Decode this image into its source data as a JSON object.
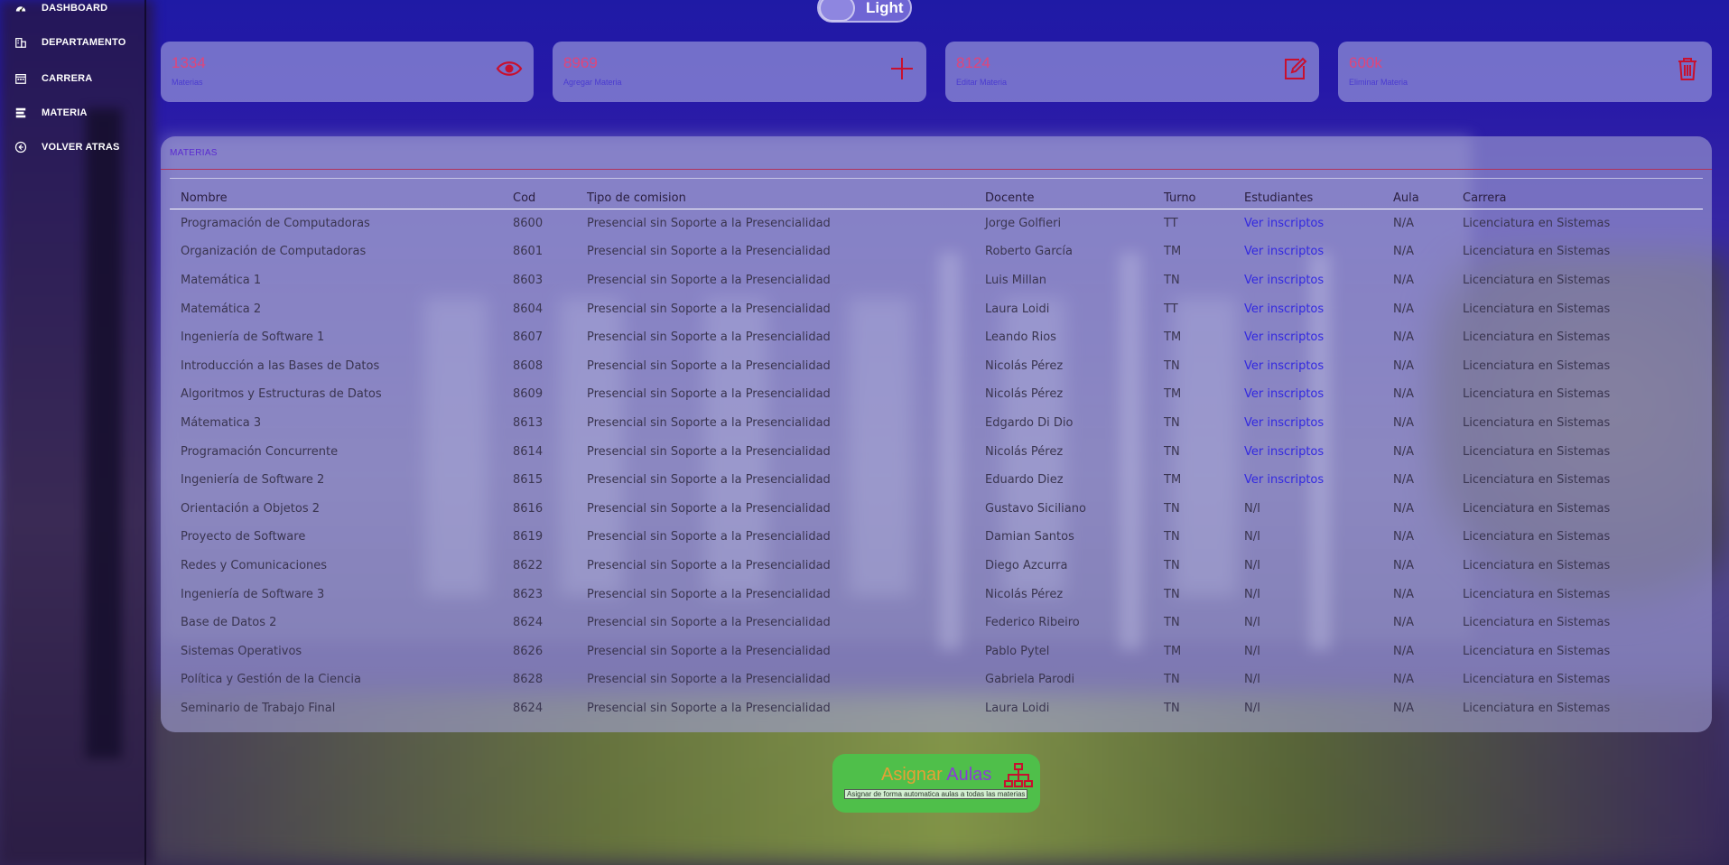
{
  "sidebar": {
    "items": [
      {
        "label": "DASHBOARD",
        "icon": "dashboard-gauge-icon"
      },
      {
        "label": "DEPARTAMENTO",
        "icon": "building-icon"
      },
      {
        "label": "CARRERA",
        "icon": "calendar-icon"
      },
      {
        "label": "MATERIA",
        "icon": "layers-icon"
      },
      {
        "label": "VOLVER ATRAS",
        "icon": "arrow-left-circle-icon"
      }
    ]
  },
  "theme_toggle": {
    "label": "Light"
  },
  "cards": [
    {
      "value": "1334",
      "label": "Materias",
      "icon": "eye-icon"
    },
    {
      "value": "8969",
      "label": "Agregar Materia",
      "icon": "plus-icon"
    },
    {
      "value": "8124",
      "label": "Editar Materia",
      "icon": "edit-icon"
    },
    {
      "value": "600k",
      "label": "Eliminar Materia",
      "icon": "trash-icon"
    }
  ],
  "colors": {
    "accent_pink": "#e0457a",
    "link_blue": "#3329e0",
    "button_green": "#4fbf4a"
  },
  "table": {
    "title": "MATERIAS",
    "headers": [
      "Nombre",
      "Cod",
      "Tipo de comision",
      "Docente",
      "Turno",
      "Estudiantes",
      "Aula",
      "Carrera"
    ],
    "rows": [
      [
        "Programación de Computadoras",
        "8600",
        "Presencial sin Soporte a la Presencialidad",
        "Jorge Golfieri",
        "TT",
        "Ver inscriptos",
        "N/A",
        "Licenciatura en Sistemas"
      ],
      [
        "Organización de Computadoras",
        "8601",
        "Presencial sin Soporte a la Presencialidad",
        "Roberto García",
        "TM",
        "Ver inscriptos",
        "N/A",
        "Licenciatura en Sistemas"
      ],
      [
        "Matemática 1",
        "8603",
        "Presencial sin Soporte a la Presencialidad",
        "Luis Millan",
        "TN",
        "Ver inscriptos",
        "N/A",
        "Licenciatura en Sistemas"
      ],
      [
        "Matemática 2",
        "8604",
        "Presencial sin Soporte a la Presencialidad",
        "Laura Loidi",
        "TT",
        "Ver inscriptos",
        "N/A",
        "Licenciatura en Sistemas"
      ],
      [
        "Ingeniería de Software 1",
        "8607",
        "Presencial sin Soporte a la Presencialidad",
        "Leando Rios",
        "TM",
        "Ver inscriptos",
        "N/A",
        "Licenciatura en Sistemas"
      ],
      [
        "Introducción a las Bases de Datos",
        "8608",
        "Presencial sin Soporte a la Presencialidad",
        "Nicolás Pérez",
        "TN",
        "Ver inscriptos",
        "N/A",
        "Licenciatura en Sistemas"
      ],
      [
        "Algoritmos y Estructuras de Datos",
        "8609",
        "Presencial sin Soporte a la Presencialidad",
        "Nicolás Pérez",
        "TM",
        "Ver inscriptos",
        "N/A",
        "Licenciatura en Sistemas"
      ],
      [
        "Mátematica 3",
        "8613",
        "Presencial sin Soporte a la Presencialidad",
        "Edgardo Di Dio",
        "TN",
        "Ver inscriptos",
        "N/A",
        "Licenciatura en Sistemas"
      ],
      [
        "Programación Concurrente",
        "8614",
        "Presencial sin Soporte a la Presencialidad",
        "Nicolás Pérez",
        "TN",
        "Ver inscriptos",
        "N/A",
        "Licenciatura en Sistemas"
      ],
      [
        "Ingeniería de Software 2",
        "8615",
        "Presencial sin Soporte a la Presencialidad",
        "Eduardo Diez",
        "TM",
        "Ver inscriptos",
        "N/A",
        "Licenciatura en Sistemas"
      ],
      [
        "Orientación a Objetos 2",
        "8616",
        "Presencial sin Soporte a la Presencialidad",
        "Gustavo Siciliano",
        "TN",
        "N/I",
        "N/A",
        "Licenciatura en Sistemas"
      ],
      [
        "Proyecto de Software",
        "8619",
        "Presencial sin Soporte a la Presencialidad",
        "Damian Santos",
        "TN",
        "N/I",
        "N/A",
        "Licenciatura en Sistemas"
      ],
      [
        "Redes y Comunicaciones",
        "8622",
        "Presencial sin Soporte a la Presencialidad",
        "Diego Azcurra",
        "TN",
        "N/I",
        "N/A",
        "Licenciatura en Sistemas"
      ],
      [
        "Ingeniería de Software 3",
        "8623",
        "Presencial sin Soporte a la Presencialidad",
        "Nicolás Pérez",
        "TN",
        "N/I",
        "N/A",
        "Licenciatura en Sistemas"
      ],
      [
        "Base de Datos 2",
        "8624",
        "Presencial sin Soporte a la Presencialidad",
        "Federico Ribeiro",
        "TN",
        "N/I",
        "N/A",
        "Licenciatura en Sistemas"
      ],
      [
        "Sistemas Operativos",
        "8626",
        "Presencial sin Soporte a la Presencialidad",
        "Pablo Pytel",
        "TM",
        "N/I",
        "N/A",
        "Licenciatura en Sistemas"
      ],
      [
        "Política y Gestión de la Ciencia",
        "8628",
        "Presencial sin Soporte a la Presencialidad",
        "Gabriela Parodi",
        "TN",
        "N/I",
        "N/A",
        "Licenciatura en Sistemas"
      ],
      [
        "Seminario de Trabajo Final",
        "8624",
        "Presencial sin Soporte a la Presencialidad",
        "Laura Loidi",
        "TN",
        "N/I",
        "N/A",
        "Licenciatura en Sistemas"
      ]
    ]
  },
  "assign_button": {
    "word1": "Asignar",
    "word2": "Aulas",
    "hint": "Asignar de forma automatica aulas a todas las materias",
    "icon": "sitemap-icon"
  }
}
